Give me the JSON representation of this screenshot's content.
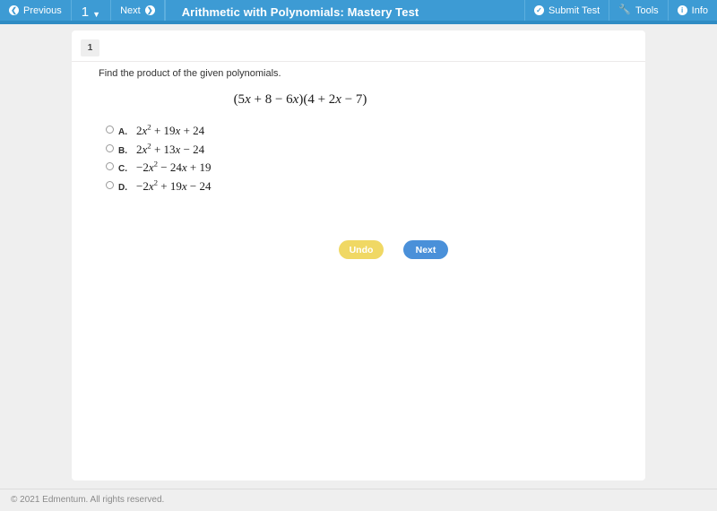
{
  "topbar": {
    "previous_label": "Previous",
    "previous_icon": "arrow-circle-left-icon",
    "page_number": "1",
    "page_chevron_icon": "chevron-down-icon",
    "next_label": "Next",
    "next_icon": "arrow-circle-right-icon",
    "title": "Arithmetic with Polynomials: Mastery Test",
    "submit_label": "Submit Test",
    "submit_icon": "check-circle-icon",
    "tools_label": "Tools",
    "tools_icon": "wrench-icon",
    "info_label": "Info",
    "info_icon": "info-circle-icon",
    "background_color": "#3d9bd4"
  },
  "question": {
    "number": "1",
    "prompt": "Find the product of the given polynomials.",
    "expression": "(5x + 8 − 6x)(4 + 2x − 7)",
    "expression_parts": {
      "open1": "(5",
      "var1": "x",
      "mid1": " + 8 − 6",
      "var2": "x",
      "close1": ")(4 + 2",
      "var3": "x",
      "close2": " − 7)"
    },
    "options": [
      {
        "letter": "A.",
        "text": "2x² + 19x + 24",
        "parts": {
          "coef": "2",
          "var": "x",
          "exp": "2",
          "rest_a": " + 19",
          "var_b": "x",
          "rest_b": " + 24"
        },
        "selected": false
      },
      {
        "letter": "B.",
        "text": "2x² + 13x − 24",
        "parts": {
          "coef": "2",
          "var": "x",
          "exp": "2",
          "rest_a": " + 13",
          "var_b": "x",
          "rest_b": " − 24"
        },
        "selected": false
      },
      {
        "letter": "C.",
        "text": "−2x² − 24x + 19",
        "parts": {
          "coef": "−2",
          "var": "x",
          "exp": "2",
          "rest_a": " − 24",
          "var_b": "x",
          "rest_b": " + 19"
        },
        "selected": false
      },
      {
        "letter": "D.",
        "text": "−2x² + 19x − 24",
        "parts": {
          "coef": "−2",
          "var": "x",
          "exp": "2",
          "rest_a": " + 19",
          "var_b": "x",
          "rest_b": " − 24"
        },
        "selected": false
      }
    ]
  },
  "actions": {
    "undo_label": "Undo",
    "undo_color": "#f0d864",
    "next_label": "Next",
    "next_color": "#4a90d9"
  },
  "footer": {
    "copyright": "© 2021 Edmentum. All rights reserved."
  }
}
